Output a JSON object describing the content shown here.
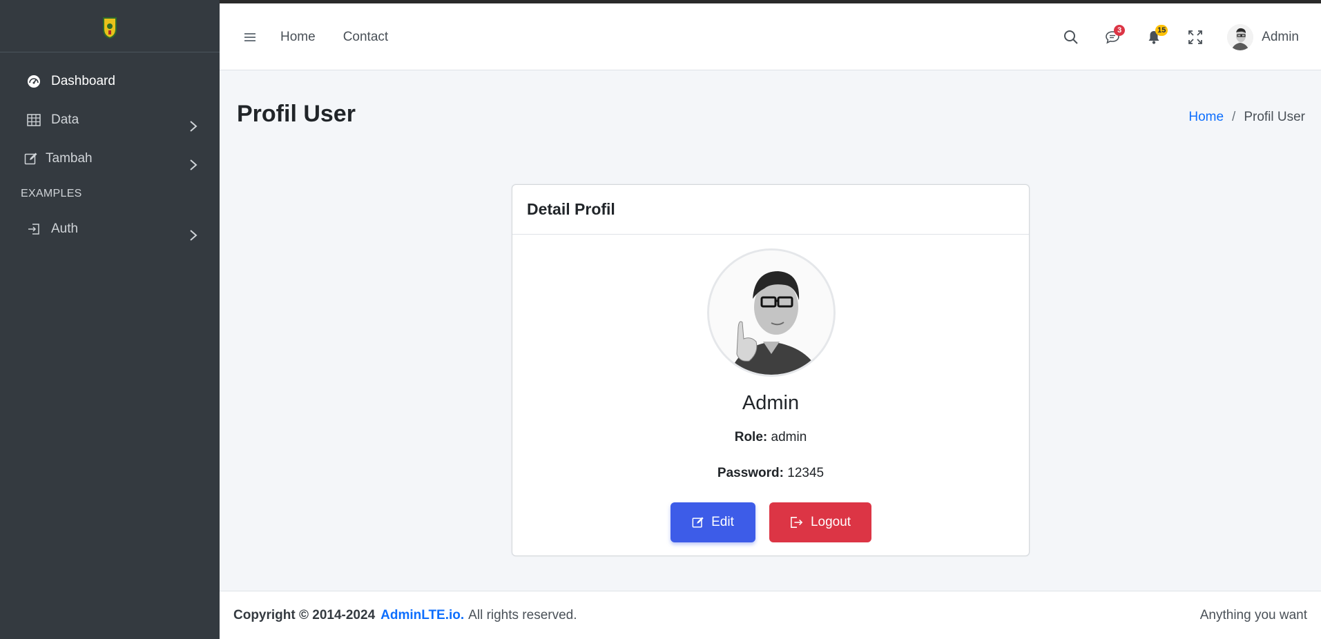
{
  "sidebar": {
    "logo_icon": "crest-logo-icon",
    "items": [
      {
        "label": "Dashboard",
        "icon": "speedometer-icon"
      },
      {
        "label": "Data",
        "icon": "table-icon"
      },
      {
        "label": "Tambah",
        "icon": "pencil-square-icon"
      }
    ],
    "section_header": "EXAMPLES",
    "section_items": [
      {
        "label": "Auth",
        "icon": "box-arrow-in-right-icon"
      }
    ]
  },
  "header": {
    "nav": {
      "home": "Home",
      "contact": "Contact"
    },
    "messages_badge": "3",
    "notifications_badge": "15",
    "user_name": "Admin"
  },
  "page": {
    "title": "Profil User",
    "breadcrumb": {
      "home": "Home",
      "separator": "/",
      "current": "Profil User"
    }
  },
  "card": {
    "title": "Detail Profil",
    "name": "Admin",
    "role_label": "Role:",
    "role_value": "admin",
    "password_label": "Password:",
    "password_value": "12345",
    "edit_label": "Edit",
    "logout_label": "Logout"
  },
  "footer": {
    "copyright": "Copyright © 2014-2024",
    "brand": "AdminLTE.io.",
    "rights": "All rights reserved.",
    "right_text": "Anything you want"
  },
  "colors": {
    "sidebar_bg": "#343a40",
    "primary_link": "#0d6efd",
    "edit_button": "#3d5ce8",
    "logout_button": "#dc3545",
    "badge_red": "#dc3545",
    "badge_yellow": "#ffc107"
  }
}
